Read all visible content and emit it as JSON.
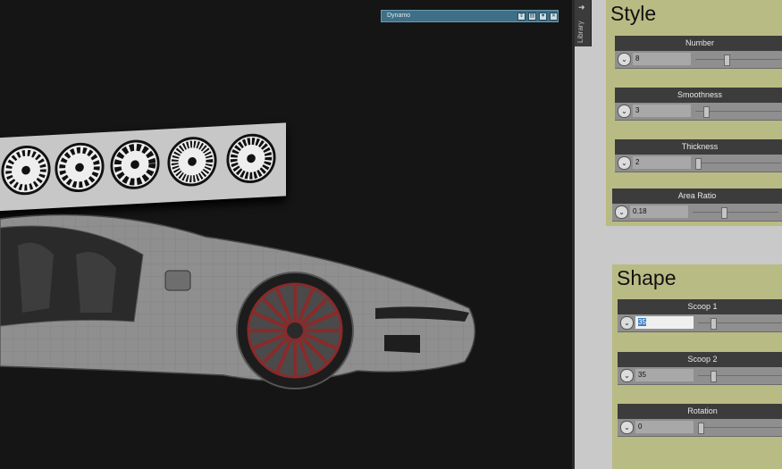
{
  "dynamo": {
    "title": "Dynamo"
  },
  "library": {
    "label": "Library"
  },
  "style_group": {
    "title": "Style",
    "nodes": [
      {
        "label": "Number",
        "value": "8",
        "slider": 0.35
      },
      {
        "label": "Smoothness",
        "value": "3",
        "slider": 0.1
      },
      {
        "label": "Thickness",
        "value": "2",
        "slider": 0.0
      },
      {
        "label": "Area Ratio",
        "value": "0.18",
        "slider": 0.35
      }
    ]
  },
  "shape_group": {
    "title": "Shape",
    "nodes": [
      {
        "label": "Scoop 1",
        "value": "35",
        "slider": 0.2
      },
      {
        "label": "Scoop 2",
        "value": "35",
        "slider": 0.2
      },
      {
        "label": "Rotation",
        "value": "0",
        "slider": 0.0
      }
    ]
  },
  "colors": {
    "group_bg": "#b9bb84",
    "node_header": "#3c3c3c",
    "dynamo_bar": "#3f6f86",
    "rim_red": "#8a2a2a"
  }
}
